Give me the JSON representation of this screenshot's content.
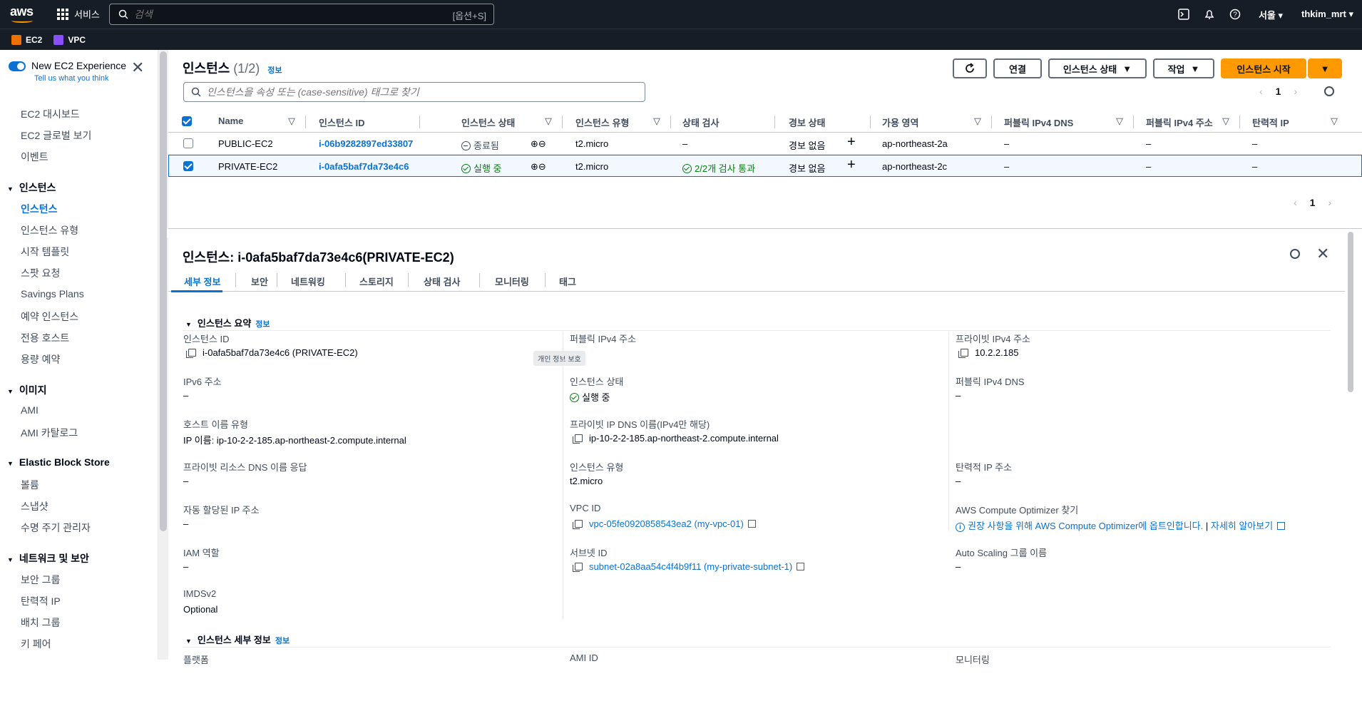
{
  "topbar": {
    "logo": "aws",
    "services_label": "서비스",
    "search_placeholder": "검색",
    "search_shortcut": "[옵션+S]",
    "region": "서울",
    "user": "thkim_mrt",
    "icons": [
      "cloudshell-icon",
      "bell-icon",
      "help-icon"
    ]
  },
  "favorites": [
    {
      "label": "EC2",
      "color": "#ed7100"
    },
    {
      "label": "VPC",
      "color": "#8c4fff"
    }
  ],
  "sidebar": {
    "new_experience": "New EC2 Experience",
    "feedback": "Tell us what you think",
    "top_items": [
      "EC2 대시보드",
      "EC2 글로벌 보기",
      "이벤트"
    ],
    "sections": [
      {
        "title": "인스턴스",
        "items": [
          "인스턴스",
          "인스턴스 유형",
          "시작 템플릿",
          "스팟 요청",
          "Savings Plans",
          "예약 인스턴스",
          "전용 호스트",
          "용량 예약"
        ]
      },
      {
        "title": "이미지",
        "items": [
          "AMI",
          "AMI 카탈로그"
        ]
      },
      {
        "title": "Elastic Block Store",
        "items": [
          "볼륨",
          "스냅샷",
          "수명 주기 관리자"
        ]
      },
      {
        "title": "네트워크 및 보안",
        "items": [
          "보안 그룹",
          "탄력적 IP",
          "배치 그룹",
          "키 페어"
        ]
      }
    ]
  },
  "instances": {
    "title": "인스턴스",
    "count": "(1/2)",
    "info": "정보",
    "buttons": {
      "connect": "연결",
      "state": "인스턴스 상태",
      "actions": "작업",
      "launch": "인스턴스 시작"
    },
    "filter_placeholder": "인스턴스을 속성 또는 (case-sensitive) 태그로 찾기",
    "page": "1",
    "columns": [
      "Name",
      "인스턴스 ID",
      "인스턴스 상태",
      "인스턴스 유형",
      "상태 검사",
      "경보 상태",
      "가용 영역",
      "퍼블릭 IPv4 DNS",
      "퍼블릭 IPv4 주소",
      "탄력적 IP"
    ],
    "rows": [
      {
        "selected": false,
        "name": "PUBLIC-EC2",
        "id": "i-06b9282897ed33807",
        "state": "종료됨",
        "type": "t2.micro",
        "check": "–",
        "alarm": "경보 없음",
        "az": "ap-northeast-2a",
        "dns": "–",
        "ip": "–",
        "eip": "–"
      },
      {
        "selected": true,
        "name": "PRIVATE-EC2",
        "id": "i-0afa5baf7da73e4c6",
        "state": "실행 중",
        "type": "t2.micro",
        "check": "2/2개 검사 통과",
        "alarm": "경보 없음",
        "az": "ap-northeast-2c",
        "dns": "–",
        "ip": "–",
        "eip": "–"
      }
    ]
  },
  "details": {
    "title": "인스턴스: i-0afa5baf7da73e4c6(PRIVATE-EC2)",
    "tabs": [
      "세부 정보",
      "보안",
      "네트워킹",
      "스토리지",
      "상태 검사",
      "모니터링",
      "태그"
    ],
    "summary_title": "인스턴스 요약",
    "info": "정보",
    "tooltip": "개인 정보 보호",
    "fields": {
      "instance_id_label": "인스턴스 ID",
      "instance_id": "i-0afa5baf7da73e4c6 (PRIVATE-EC2)",
      "public_ipv4_label": "퍼블릭 IPv4 주소",
      "private_ipv4_label": "프라이빗 IPv4 주소",
      "private_ipv4": "10.2.2.185",
      "ipv6_label": "IPv6 주소",
      "ipv6": "–",
      "state_label": "인스턴스 상태",
      "state": "실행 중",
      "public_dns_label": "퍼블릭 IPv4 DNS",
      "public_dns": "–",
      "hostname_type_label": "호스트 이름 유형",
      "hostname_type": "IP 이름: ip-10-2-2-185.ap-northeast-2.compute.internal",
      "private_dns_label": "프라이빗 IP DNS 이름(IPv4만 해당)",
      "private_dns": "ip-10-2-2-185.ap-northeast-2.compute.internal",
      "resource_dns_label": "프라이빗 리소스 DNS 이름 응답",
      "resource_dns": "–",
      "type_label": "인스턴스 유형",
      "type": "t2.micro",
      "eip_label": "탄력적 IP 주소",
      "eip": "–",
      "auto_ip_label": "자동 할당된 IP 주소",
      "auto_ip": "–",
      "vpc_label": "VPC ID",
      "vpc": "vpc-05fe0920858543ea2 (my-vpc-01)",
      "optimizer_label": "AWS Compute Optimizer 찾기",
      "optimizer": "권장 사항을 위해 AWS Compute Optimizer에 옵트인합니다.",
      "learn_more": "자세히 알아보기",
      "iam_label": "IAM 역할",
      "iam": "–",
      "subnet_label": "서브넷 ID",
      "subnet": "subnet-02a8aa54c4f4b9f11 (my-private-subnet-1)",
      "asg_label": "Auto Scaling 그룹 이름",
      "asg": "–",
      "imds_label": "IMDSv2",
      "imds": "Optional"
    },
    "detail_section_title": "인스턴스 세부 정보",
    "bottom_labels": [
      "플랫폼",
      "AMI ID",
      "모니터링"
    ]
  }
}
